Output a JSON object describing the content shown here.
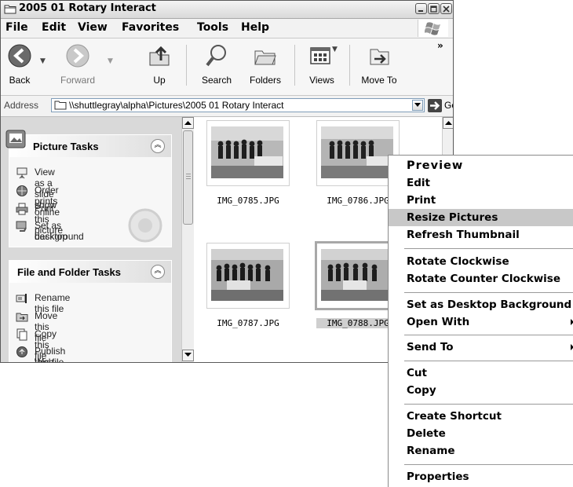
{
  "window": {
    "title": "2005 01 Rotary Interact"
  },
  "menubar": {
    "items": [
      "File",
      "Edit",
      "View",
      "Favorites",
      "Tools",
      "Help"
    ]
  },
  "toolbar": {
    "back": "Back",
    "forward": "Forward",
    "up": "Up",
    "search": "Search",
    "folders": "Folders",
    "views": "Views",
    "move_to": "Move To",
    "overflow": "»"
  },
  "address": {
    "label": "Address",
    "value": "\\\\shuttlegray\\alpha\\Pictures\\2005 01 Rotary Interact",
    "go": "Go"
  },
  "picture_tasks": {
    "title": "Picture Tasks",
    "items": [
      "View as a slide show",
      "Order prints online",
      "Print this picture",
      "Set as desktop",
      "background"
    ]
  },
  "file_tasks": {
    "title": "File and Folder Tasks",
    "items": [
      "Rename this file",
      "Move this file",
      "Copy this file",
      "Publish this file to the",
      "Web"
    ]
  },
  "files": [
    {
      "name": "IMG_0785.JPG"
    },
    {
      "name": "IMG_0786.JPG"
    },
    {
      "name": "IMG_0787.JPG"
    },
    {
      "name": "IMG_0788.JPG"
    }
  ],
  "context_menu": {
    "items": [
      "Preview",
      "Edit",
      "Print",
      "Resize Pictures",
      "Refresh Thumbnail",
      "Rotate Clockwise",
      "Rotate Counter Clockwise",
      "Set as Desktop Background",
      "Open With",
      "Send To",
      "Cut",
      "Copy",
      "Create Shortcut",
      "Delete",
      "Rename",
      "Properties"
    ],
    "highlighted": "Resize Pictures"
  },
  "colors": {
    "highlight": "#c8c8c8",
    "task_pane_bg": "#d9d9d9"
  }
}
